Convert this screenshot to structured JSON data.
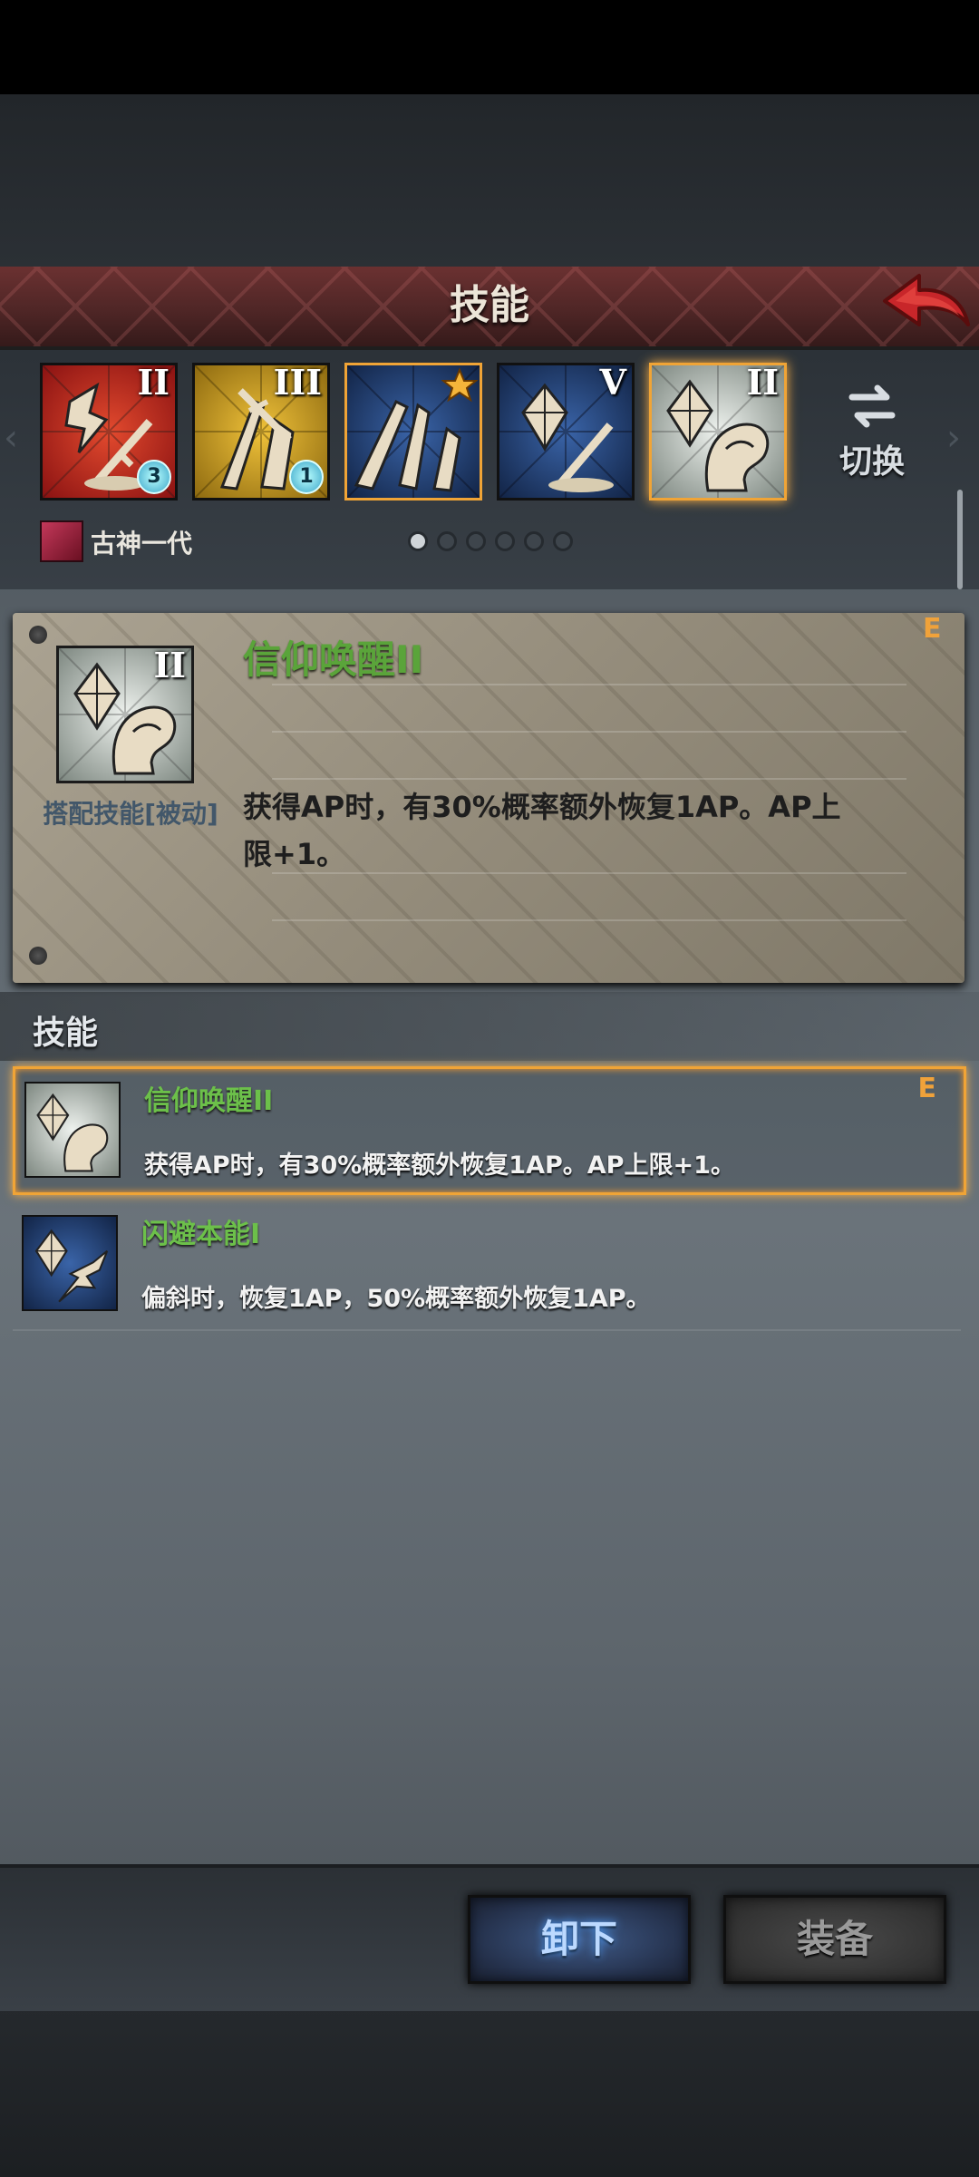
{
  "header": {
    "title": "技能"
  },
  "strip": {
    "slots": [
      {
        "roman": "II",
        "gem": "3",
        "theme": "red"
      },
      {
        "roman": "III",
        "gem": "1",
        "theme": "gold"
      },
      {
        "roman": "",
        "gem": "",
        "theme": "blue",
        "starred": true
      },
      {
        "roman": "V",
        "gem": "",
        "theme": "blue"
      },
      {
        "roman": "II",
        "gem": "",
        "theme": "white",
        "selected": true
      }
    ],
    "switch_label": "切换",
    "character_name": "古神一代",
    "pages": 6,
    "current_page": 1
  },
  "detail": {
    "roman": "II",
    "tag": "搭配技能[被动]",
    "name": "信仰唤醒II",
    "grade": "E",
    "description": "获得AP时，有30%概率额外恢复1AP。AP上限+1。"
  },
  "list": {
    "title": "技能",
    "items": [
      {
        "name": "信仰唤醒II",
        "desc": "获得AP时，有30%概率额外恢复1AP。AP上限+1。",
        "grade": "E",
        "selected": true
      },
      {
        "name": "闪避本能I",
        "desc": "偏斜时，恢复1AP，50%概率额外恢复1AP。",
        "grade": "",
        "selected": false
      }
    ]
  },
  "buttons": {
    "unload": "卸下",
    "equip": "装备"
  },
  "colors": {
    "accent_orange": "#f0a436",
    "skill_name_green": "#6cc04a",
    "header_red": "#5a2a2a"
  }
}
